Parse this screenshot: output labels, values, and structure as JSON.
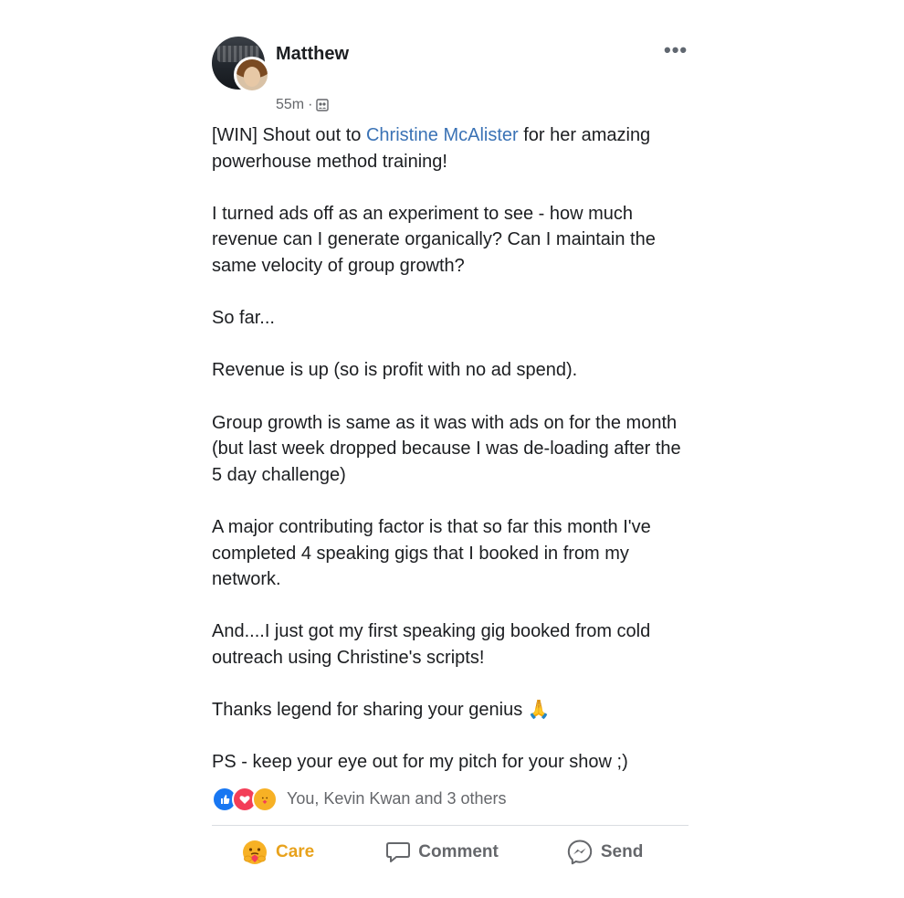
{
  "post": {
    "author": "Matthew",
    "time": "55m",
    "separator": "·",
    "more_label": "•••",
    "body": {
      "p1_before": "[WIN] Shout out to ",
      "p1_mention": "Christine McAlister",
      "p1_after": " for her amazing powerhouse method training!",
      "p2": "I turned ads off as an experiment to see - how much revenue can I generate organically? Can I maintain the same velocity of group growth?",
      "p3": "So far...",
      "p4": "Revenue is up (so is profit with no ad spend).",
      "p5": "Group growth is same as it was with ads on for the month (but last week dropped because I was de-loading after the 5 day challenge)",
      "p6": "A major contributing factor is that so far this month I've completed 4 speaking gigs that I booked in from my network.",
      "p7": "And....I just got my first speaking gig booked from cold outreach using Christine's scripts!",
      "p8": "Thanks legend for sharing your genius ",
      "p8_emoji": "🙏",
      "p9": "PS - keep your eye out for my pitch for your show ;)"
    },
    "reactions": {
      "icons": [
        "like-icon",
        "love-icon",
        "care-icon"
      ],
      "summary": "You, Kevin Kwan and 3 others"
    },
    "actions": {
      "care": "Care",
      "comment": "Comment",
      "send": "Send"
    },
    "colors": {
      "mention": "#3a72b5",
      "care_active": "#e8a21c",
      "muted": "#65676b"
    }
  }
}
